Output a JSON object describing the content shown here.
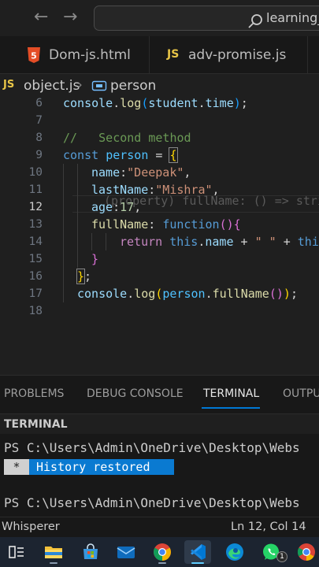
{
  "titlebar": {
    "command_center_text": "learning_"
  },
  "tabs": [
    {
      "label": "Dom-js.html",
      "icon": "html5-icon",
      "icon_glyph": "5"
    },
    {
      "label": "adv-promise.js",
      "icon": "javascript-icon",
      "icon_glyph": "JS"
    }
  ],
  "breadcrumb": {
    "file_badge": "JS",
    "file": "object.js",
    "separator": "›",
    "symbol": "person"
  },
  "editor": {
    "line_numbers": [
      "6",
      "7",
      "8",
      "9",
      "10",
      "11",
      "12",
      "13",
      "14",
      "15",
      "16",
      "17",
      "18"
    ],
    "active_line": "12",
    "inline_hint": "(property) fullName: () => stri",
    "lines": {
      "l6": {
        "obj": "console",
        "dot": ".",
        "method": "log",
        "open": "(",
        "arg_obj": "student",
        "dot2": ".",
        "arg_prop": "time",
        "close": ")",
        "semi": ";"
      },
      "l8": {
        "comment": "//   Second method"
      },
      "l9": {
        "kw": "const",
        "name": "person",
        "eq": "=",
        "brace": "{"
      },
      "l10": {
        "key": "name",
        "colon": ":",
        "value": "\"Deepak\"",
        "comma": ","
      },
      "l11": {
        "key": "lastName",
        "colon": ":",
        "value": "\"Mishra\"",
        "comma": ","
      },
      "l12": {
        "key": "age",
        "colon": ":",
        "value": "17",
        "comma": ","
      },
      "l13": {
        "key": "fullName",
        "colon": ":",
        "kw": "function",
        "parens": "()",
        "brace": "{"
      },
      "l14": {
        "ret": "return",
        "this": "this",
        "dot": ".",
        "prop": "name",
        "plus": "+",
        "str": "\" \"",
        "plus2": "+",
        "this2": "this"
      },
      "l15": {
        "brace": "}"
      },
      "l16": {
        "brace": "}",
        "semi": ";"
      },
      "l17": {
        "obj": "console",
        "dot": ".",
        "method": "log",
        "open": "(",
        "arg_obj": "person",
        "dot2": ".",
        "arg_method": "fullName",
        "call": "()",
        "close": ")",
        "semi": ";"
      }
    }
  },
  "panel": {
    "tabs": [
      "PROBLEMS",
      "DEBUG CONSOLE",
      "TERMINAL",
      "OUTPU"
    ],
    "active_tab": "TERMINAL",
    "terminal_header": "TERMINAL",
    "prompt_1": "PS C:\\Users\\Admin\\OneDrive\\Desktop\\Webs",
    "history_star": "*",
    "history_text": "History restored",
    "prompt_2": "PS C:\\Users\\Admin\\OneDrive\\Desktop\\Webs"
  },
  "statusbar": {
    "left": "Whisperer",
    "cursor": "Ln 12, Col 14"
  },
  "taskbar": {
    "items": [
      "task-view-icon",
      "file-explorer-icon",
      "microsoft-store-icon",
      "mail-icon",
      "chrome-icon",
      "vscode-icon",
      "edge-icon",
      "whatsapp-icon",
      "chrome-profile-icon"
    ],
    "whatsapp_badge": "1"
  },
  "colors": {
    "keyword": "#569cd6",
    "string": "#ce9178",
    "property": "#9cdcfe",
    "comment": "#6a9955",
    "number": "#b5cea8",
    "function": "#dcdcaa",
    "accent": "#0078d4",
    "js_yellow": "#e8c547",
    "html_orange": "#e44d26"
  }
}
